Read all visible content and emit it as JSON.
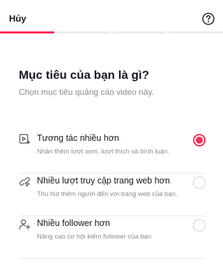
{
  "header": {
    "cancel_label": "Hủy",
    "help_icon": "question-circle-icon"
  },
  "progress": {
    "steps": 4,
    "current_step": 1,
    "accent_color": "#fe2c55"
  },
  "main": {
    "title": "Mục tiêu của bạn là gì?",
    "subtitle": "Chọn mục tiêu quảng cáo video này."
  },
  "options": [
    {
      "icon": "video-play-icon",
      "title": "Tương tác nhiều hơn",
      "description": "Nhận thêm lượt xem, lượt thích và bình luận.",
      "selected": true
    },
    {
      "icon": "link-pointer-icon",
      "title": "Nhiều lượt truy cập trang web hơn",
      "description": "Thu hút thêm người đến với trang web của bạn.",
      "selected": false
    },
    {
      "icon": "person-add-icon",
      "title": "Nhiều follower hơn",
      "description": "Nâng cao cơ hội kiếm follower của bạn",
      "selected": false
    }
  ]
}
